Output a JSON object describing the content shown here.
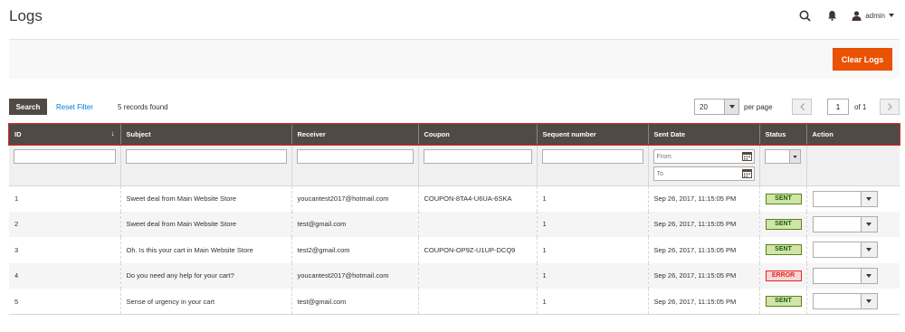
{
  "header": {
    "title": "Logs",
    "user": "admin"
  },
  "actions": {
    "clear_label": "Clear Logs"
  },
  "toolbar": {
    "search_label": "Search",
    "reset_label": "Reset Filter",
    "records": "5 records found",
    "per_page_value": "20",
    "per_page_label": "per page",
    "page": "1",
    "page_of": "of 1"
  },
  "columns": [
    "ID",
    "Subject",
    "Receiver",
    "Coupon",
    "Sequent number",
    "Sent Date",
    "Status",
    "Action"
  ],
  "filters": {
    "date_from": "From",
    "date_to": "To"
  },
  "rows": [
    {
      "id": "1",
      "subject": "Sweet deal from Main Website Store",
      "receiver": "youcantest2017@hotmail.com",
      "coupon": "COUPON-8TA4-U6UA-6SKA",
      "seq": "1",
      "sent": "Sep 26, 2017, 11:15:05 PM",
      "status": "SENT"
    },
    {
      "id": "2",
      "subject": "Sweet deal from Main Website Store",
      "receiver": "test@gmail.com",
      "coupon": "",
      "seq": "1",
      "sent": "Sep 26, 2017, 11:15:05 PM",
      "status": "SENT"
    },
    {
      "id": "3",
      "subject": "Oh. Is this your cart in Main Website Store",
      "receiver": "test2@gmail.com",
      "coupon": "COUPON-OP9Z-U1UP-DCQ9",
      "seq": "1",
      "sent": "Sep 26, 2017, 11:15:05 PM",
      "status": "SENT"
    },
    {
      "id": "4",
      "subject": "Do you need any help for your cart?",
      "receiver": "youcantest2017@hotmail.com",
      "coupon": "",
      "seq": "1",
      "sent": "Sep 26, 2017, 11:15:05 PM",
      "status": "ERROR"
    },
    {
      "id": "5",
      "subject": "Sense of urgency in your cart",
      "receiver": "test@gmail.com",
      "coupon": "",
      "seq": "1",
      "sent": "Sep 26, 2017, 11:15:05 PM",
      "status": "SENT"
    }
  ],
  "colors": {
    "accent": "#eb5202",
    "header_bg": "#514943",
    "highlight": "#e22626",
    "link": "#007bdb"
  }
}
